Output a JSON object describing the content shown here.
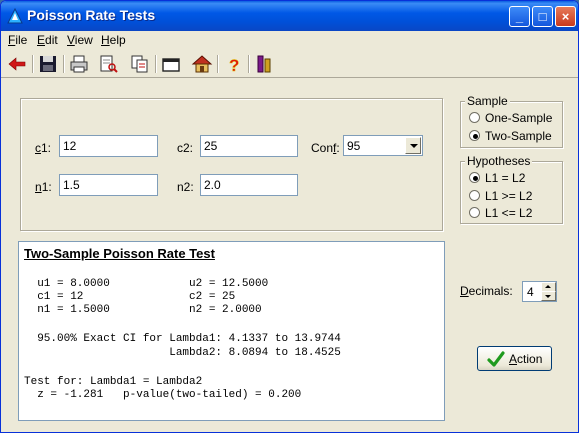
{
  "window": {
    "title": "Poisson Rate Tests",
    "minimize": "_",
    "maximize": "□",
    "close": "×"
  },
  "menu": [
    {
      "label": "File",
      "key": "F",
      "rest": "ile"
    },
    {
      "label": "Edit",
      "key": "E",
      "rest": "dit"
    },
    {
      "label": "View",
      "key": "V",
      "rest": "iew"
    },
    {
      "label": "Help",
      "key": "H",
      "rest": "elp"
    }
  ],
  "toolbar": {
    "icons": [
      "back-arrow-icon",
      "save-icon",
      "print-icon",
      "print-preview-icon",
      "copy-icon",
      "new-window-icon",
      "home-icon",
      "help-icon",
      "info-icon"
    ]
  },
  "inputs": {
    "c1": {
      "key": "c",
      "rest": "1:",
      "value": "12"
    },
    "c2": {
      "label": "c2:",
      "value": "25"
    },
    "conf": {
      "prefix": "Con",
      "key": "f",
      "rest": ":",
      "value": "95"
    },
    "n1": {
      "key": "n",
      "rest": "1:",
      "value": "1.5"
    },
    "n2": {
      "label": "n2:",
      "value": "2.0"
    }
  },
  "sample": {
    "title": "Sample",
    "options": [
      {
        "label": "One-Sample",
        "selected": false
      },
      {
        "label": "Two-Sample",
        "selected": true
      }
    ]
  },
  "hypotheses": {
    "title": "Hypotheses",
    "options": [
      {
        "label": "L1  =  L2",
        "selected": true
      },
      {
        "label": "L1 >= L2",
        "selected": false
      },
      {
        "label": "L1 <= L2",
        "selected": false
      }
    ]
  },
  "output": {
    "title": "Two-Sample Poisson Rate Test",
    "lines": [
      "  u1 = 8.0000            u2 = 12.5000",
      "  c1 = 12                c2 = 25",
      "  n1 = 1.5000            n2 = 2.0000",
      "",
      "  95.00% Exact CI for Lambda1: 4.1337 to 13.9744",
      "                      Lambda2: 8.0894 to 18.4525",
      "",
      "Test for: Lambda1 = Lambda2",
      "  z = -1.281   p-value(two-tailed) = 0.200"
    ]
  },
  "decimals": {
    "key": "D",
    "rest": "ecimals:",
    "value": "4"
  },
  "action": {
    "key": "A",
    "rest": "ction",
    "icon": "checkmark-icon"
  },
  "colors": {
    "accent": "#0058e6",
    "check": "#1e9a1e"
  }
}
